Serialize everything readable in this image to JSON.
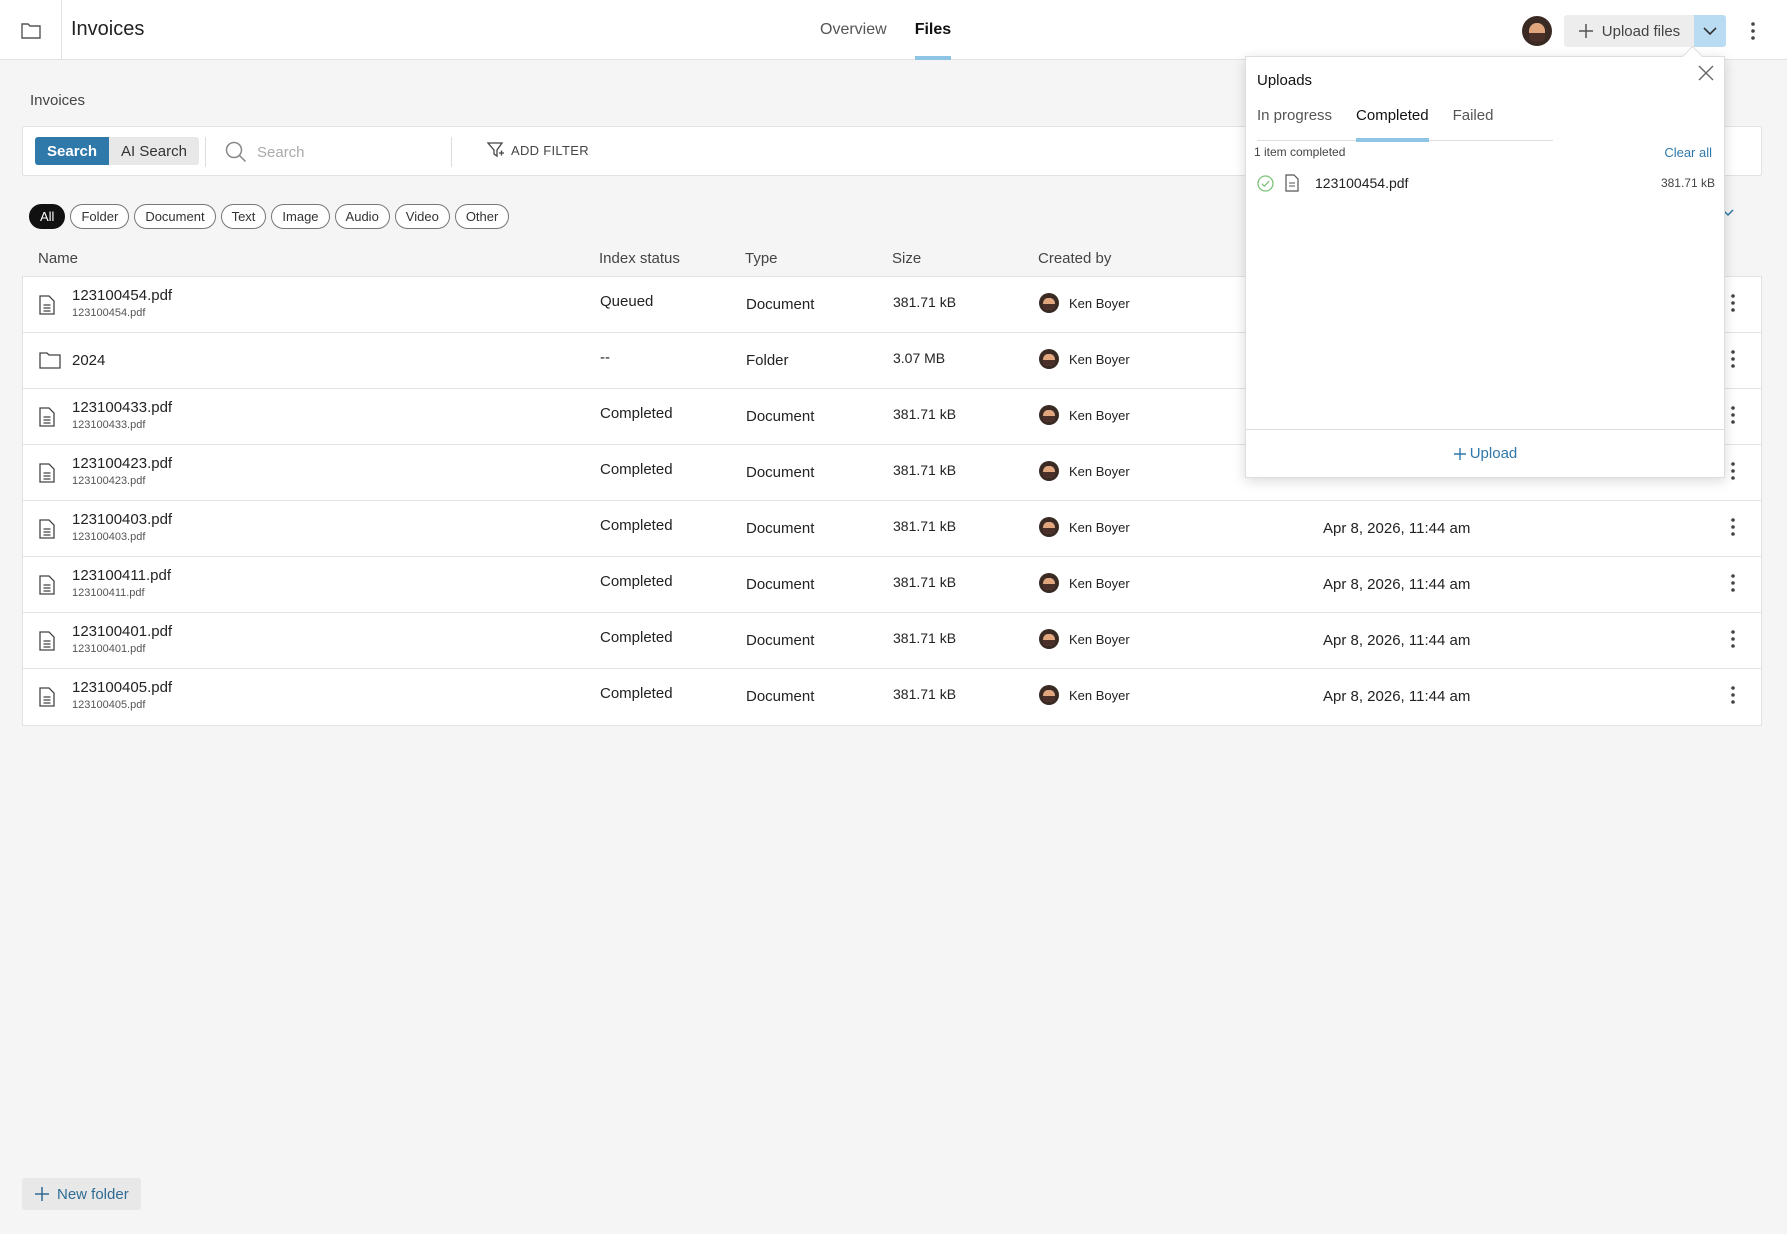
{
  "header": {
    "title": "Invoices",
    "tabs": [
      {
        "label": "Overview",
        "active": false
      },
      {
        "label": "Files",
        "active": true
      }
    ],
    "upload_files_label": "Upload files"
  },
  "breadcrumb": "Invoices",
  "search": {
    "modes": [
      "Search",
      "AI Search"
    ],
    "placeholder": "Search",
    "add_filter_label": "ADD FILTER"
  },
  "filters": {
    "chips": [
      "All",
      "Folder",
      "Document",
      "Text",
      "Image",
      "Audio",
      "Video",
      "Other"
    ],
    "active": "All"
  },
  "table": {
    "columns": [
      "Name",
      "Index status",
      "Type",
      "Size",
      "Created by"
    ],
    "rows": [
      {
        "kind": "document",
        "name": "123100454.pdf",
        "sub": "123100454.pdf",
        "status": "Queued",
        "type": "Document",
        "size": "381.71 kB",
        "creator": "Ken Boyer",
        "date": ""
      },
      {
        "kind": "folder",
        "name": "2024",
        "sub": "",
        "status": "--",
        "type": "Folder",
        "size": "3.07 MB",
        "creator": "Ken Boyer",
        "date": ""
      },
      {
        "kind": "document",
        "name": "123100433.pdf",
        "sub": "123100433.pdf",
        "status": "Completed",
        "type": "Document",
        "size": "381.71 kB",
        "creator": "Ken Boyer",
        "date": ""
      },
      {
        "kind": "document",
        "name": "123100423.pdf",
        "sub": "123100423.pdf",
        "status": "Completed",
        "type": "Document",
        "size": "381.71 kB",
        "creator": "Ken Boyer",
        "date": ""
      },
      {
        "kind": "document",
        "name": "123100403.pdf",
        "sub": "123100403.pdf",
        "status": "Completed",
        "type": "Document",
        "size": "381.71 kB",
        "creator": "Ken Boyer",
        "date": "Apr 8, 2026, 11:44 am"
      },
      {
        "kind": "document",
        "name": "123100411.pdf",
        "sub": "123100411.pdf",
        "status": "Completed",
        "type": "Document",
        "size": "381.71 kB",
        "creator": "Ken Boyer",
        "date": "Apr 8, 2026, 11:44 am"
      },
      {
        "kind": "document",
        "name": "123100401.pdf",
        "sub": "123100401.pdf",
        "status": "Completed",
        "type": "Document",
        "size": "381.71 kB",
        "creator": "Ken Boyer",
        "date": "Apr 8, 2026, 11:44 am"
      },
      {
        "kind": "document",
        "name": "123100405.pdf",
        "sub": "123100405.pdf",
        "status": "Completed",
        "type": "Document",
        "size": "381.71 kB",
        "creator": "Ken Boyer",
        "date": "Apr 8, 2026, 11:44 am"
      }
    ]
  },
  "new_folder_label": "New folder",
  "uploads": {
    "title": "Uploads",
    "tabs": [
      {
        "label": "In progress",
        "active": false
      },
      {
        "label": "Completed",
        "active": true
      },
      {
        "label": "Failed",
        "active": false
      }
    ],
    "count_text": "1 item completed",
    "clear_all_label": "Clear all",
    "items": [
      {
        "name": "123100454.pdf",
        "size": "381.71 kB"
      }
    ],
    "upload_label": "Upload"
  },
  "colors": {
    "accent": "#2f78aa",
    "tab_underline": "#8ec4e4",
    "success": "#7cc47a"
  },
  "icons": {
    "folder": "folder-icon",
    "document": "document-icon",
    "search": "search-icon",
    "filter": "filter-icon",
    "plus": "plus-icon",
    "chevron": "chevron-down-icon",
    "kebab": "kebab-icon",
    "close": "close-icon",
    "check": "check-circle-icon",
    "list_view": "list-view-icon"
  }
}
